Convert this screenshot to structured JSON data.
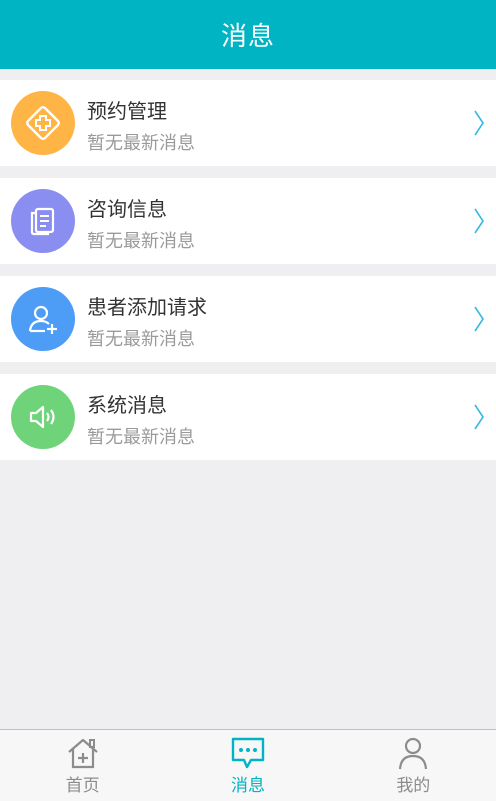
{
  "header": {
    "title": "消息"
  },
  "messages": [
    {
      "title": "预约管理",
      "subtitle": "暂无最新消息",
      "icon": "diamond-cross-icon",
      "color": "#ffb545"
    },
    {
      "title": "咨询信息",
      "subtitle": "暂无最新消息",
      "icon": "document-icon",
      "color": "#8a8ef0"
    },
    {
      "title": "患者添加请求",
      "subtitle": "暂无最新消息",
      "icon": "add-user-icon",
      "color": "#4d9cf5"
    },
    {
      "title": "系统消息",
      "subtitle": "暂无最新消息",
      "icon": "speaker-icon",
      "color": "#6fd37a"
    }
  ],
  "tabbar": {
    "tabs": [
      {
        "label": "首页",
        "icon": "home-icon",
        "active": false
      },
      {
        "label": "消息",
        "icon": "chat-icon",
        "active": true
      },
      {
        "label": "我的",
        "icon": "person-icon",
        "active": false
      }
    ]
  },
  "colors": {
    "accent": "#00b4c4",
    "chevron": "#35b8e5"
  }
}
